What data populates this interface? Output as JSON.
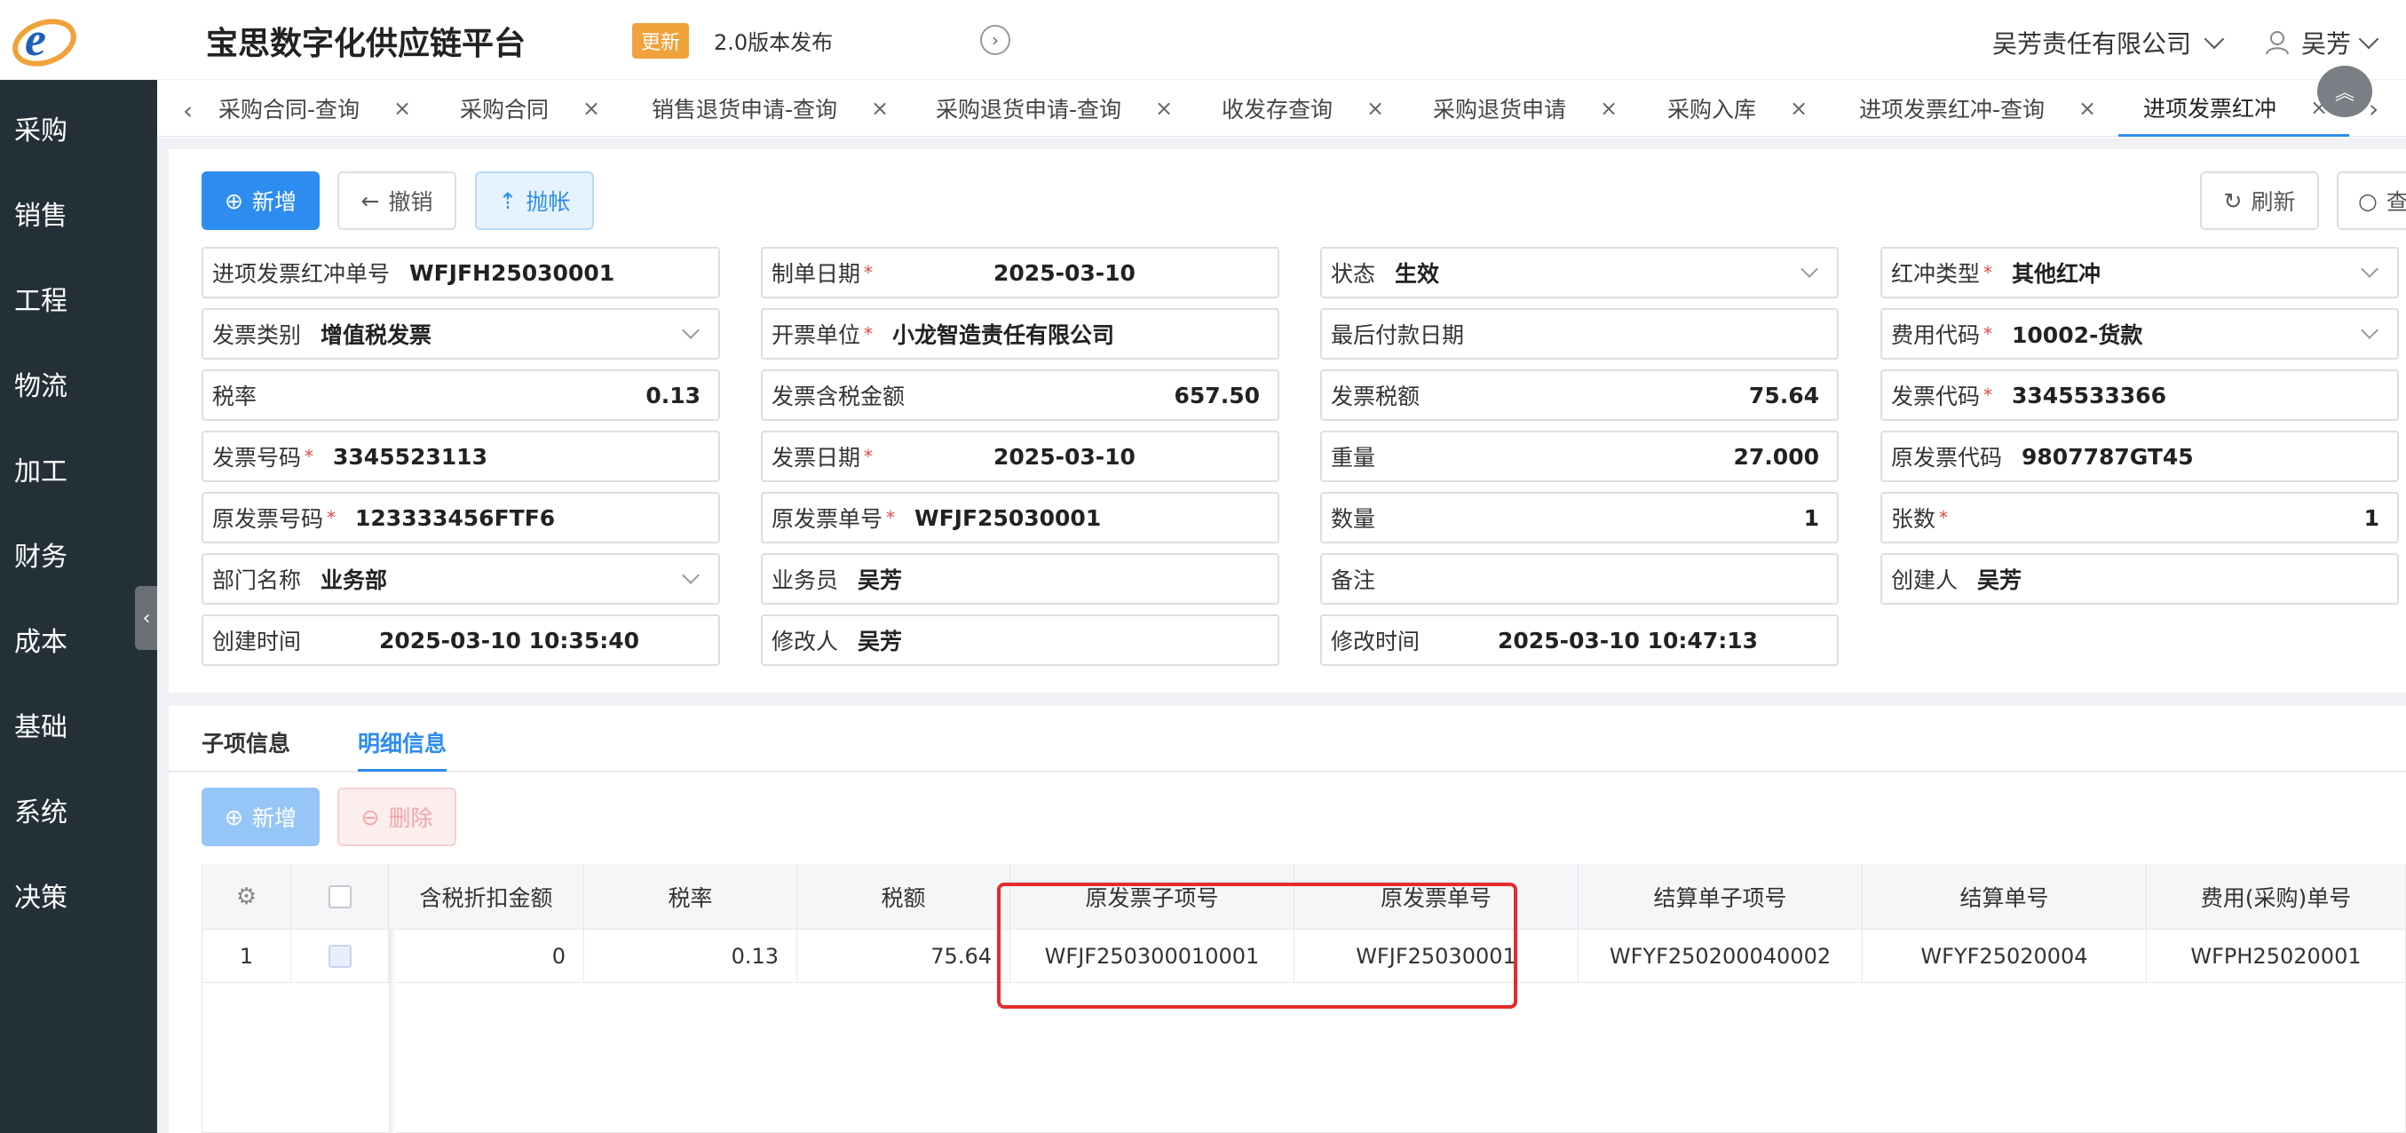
{
  "header": {
    "app_title": "宝思数字化供应链平台",
    "update_badge": "更新",
    "update_text": "2.0版本发布",
    "company": "吴芳责任有限公司",
    "user": "吴芳"
  },
  "sidebar": {
    "items": [
      "采购",
      "销售",
      "工程",
      "物流",
      "加工",
      "财务",
      "成本",
      "基础",
      "系统",
      "决策"
    ]
  },
  "tabs": [
    {
      "label": "采购合同-查询"
    },
    {
      "label": "采购合同"
    },
    {
      "label": "销售退货申请-查询"
    },
    {
      "label": "采购退货申请-查询"
    },
    {
      "label": "收发存查询"
    },
    {
      "label": "采购退货申请"
    },
    {
      "label": "采购入库"
    },
    {
      "label": "进项发票红冲-查询"
    },
    {
      "label": "进项发票红冲",
      "active": true
    }
  ],
  "toolbar": {
    "add": "新增",
    "revoke": "撤销",
    "post": "抛帐",
    "refresh": "刷新",
    "query": "查"
  },
  "form": {
    "row1": {
      "red_no_label": "进项发票红冲单号",
      "red_no": "WFJFH25030001",
      "date_label": "制单日期",
      "date": "2025-03-10",
      "status_label": "状态",
      "status": "生效",
      "red_type_label": "红冲类型",
      "red_type": "其他红冲"
    },
    "row2": {
      "inv_cat_label": "发票类别",
      "inv_cat": "增值税发票",
      "issuer_label": "开票单位",
      "issuer": "小龙智造责任有限公司",
      "last_pay_label": "最后付款日期",
      "last_pay": "",
      "fee_code_label": "费用代码",
      "fee_code": "10002-货款"
    },
    "row3": {
      "tax_rate_label": "税率",
      "tax_rate": "0.13",
      "amount_label": "发票含税金额",
      "amount": "657.50",
      "tax_amt_label": "发票税额",
      "tax_amt": "75.64",
      "inv_code_label": "发票代码",
      "inv_code": "3345533366"
    },
    "row4": {
      "inv_no_label": "发票号码",
      "inv_no": "3345523113",
      "inv_date_label": "发票日期",
      "inv_date": "2025-03-10",
      "weight_label": "重量",
      "weight": "27.000",
      "orig_code_label": "原发票代码",
      "orig_code": "9807787GT45"
    },
    "row5": {
      "orig_no_label": "原发票号码",
      "orig_no": "123333456FTF6",
      "orig_bill_label": "原发票单号",
      "orig_bill": "WFJF25030001",
      "qty_label": "数量",
      "qty": "1",
      "sheets_label": "张数",
      "sheets": "1"
    },
    "row6": {
      "dept_label": "部门名称",
      "dept": "业务部",
      "sales_label": "业务员",
      "sales": "吴芳",
      "remark_label": "备注",
      "remark": "",
      "creator_label": "创建人",
      "creator": "吴芳"
    },
    "row7": {
      "created_label": "创建时间",
      "created": "2025-03-10 10:35:40",
      "modifier_label": "修改人",
      "modifier": "吴芳",
      "modified_label": "修改时间",
      "modified": "2025-03-10 10:47:13"
    }
  },
  "subtabs": {
    "items": [
      "子项信息",
      "明细信息"
    ],
    "active": "明细信息"
  },
  "detail_toolbar": {
    "add": "新增",
    "delete": "删除"
  },
  "grid": {
    "columns": [
      "含税折扣金额",
      "税率",
      "税额",
      "原发票子项号",
      "原发票单号",
      "结算单子项号",
      "结算单号",
      "费用(采购)单号"
    ],
    "rows": [
      {
        "index": "1",
        "discount_amount": "0",
        "tax_rate": "0.13",
        "tax": "75.64",
        "orig_item_no": "WFJF250300010001",
        "orig_bill_no": "WFJF25030001",
        "settle_item_no": "WFYF250200040002",
        "settle_no": "WFYF25020004",
        "fee_no": "WFPH25020001"
      }
    ]
  },
  "colors": {
    "primary": "#2d8cf0",
    "sidebar": "#243038",
    "badge": "#f0a23b",
    "highlight": "#e52b2b"
  }
}
